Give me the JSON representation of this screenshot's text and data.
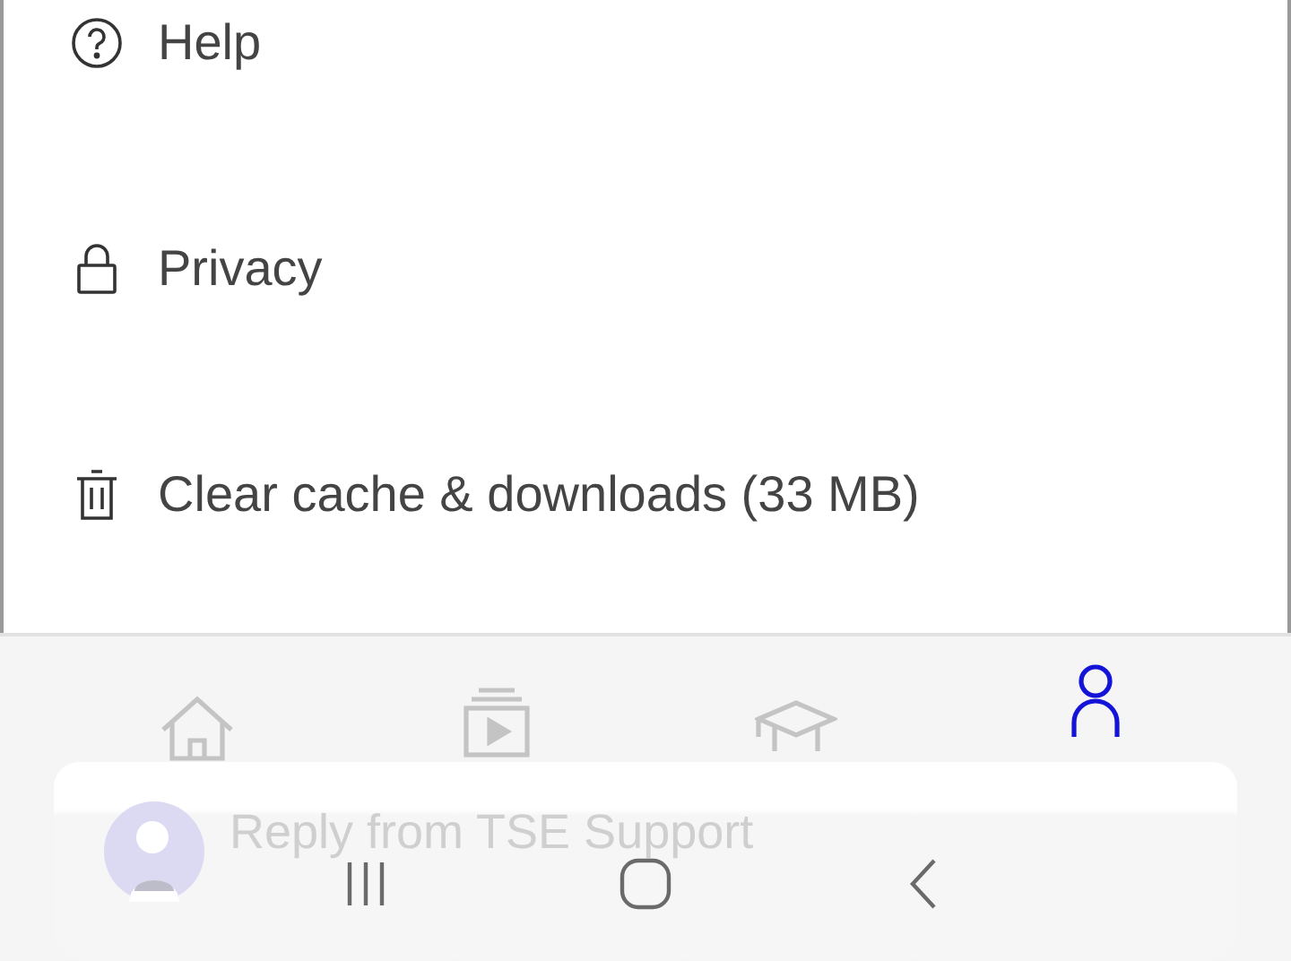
{
  "menu": [
    {
      "kind": "help",
      "label": "Help"
    },
    {
      "kind": "privacy",
      "label": "Privacy"
    },
    {
      "kind": "trash",
      "label": "Clear cache & downloads (33 MB)"
    }
  ],
  "bottom_nav": [
    {
      "kind": "home",
      "selected": false
    },
    {
      "kind": "videos",
      "selected": false
    },
    {
      "kind": "courses",
      "selected": false
    },
    {
      "kind": "profile",
      "selected": true
    }
  ],
  "notification": {
    "text": "Reply from TSE Support"
  },
  "system_nav": [
    {
      "kind": "recents"
    },
    {
      "kind": "home"
    },
    {
      "kind": "back"
    }
  ]
}
